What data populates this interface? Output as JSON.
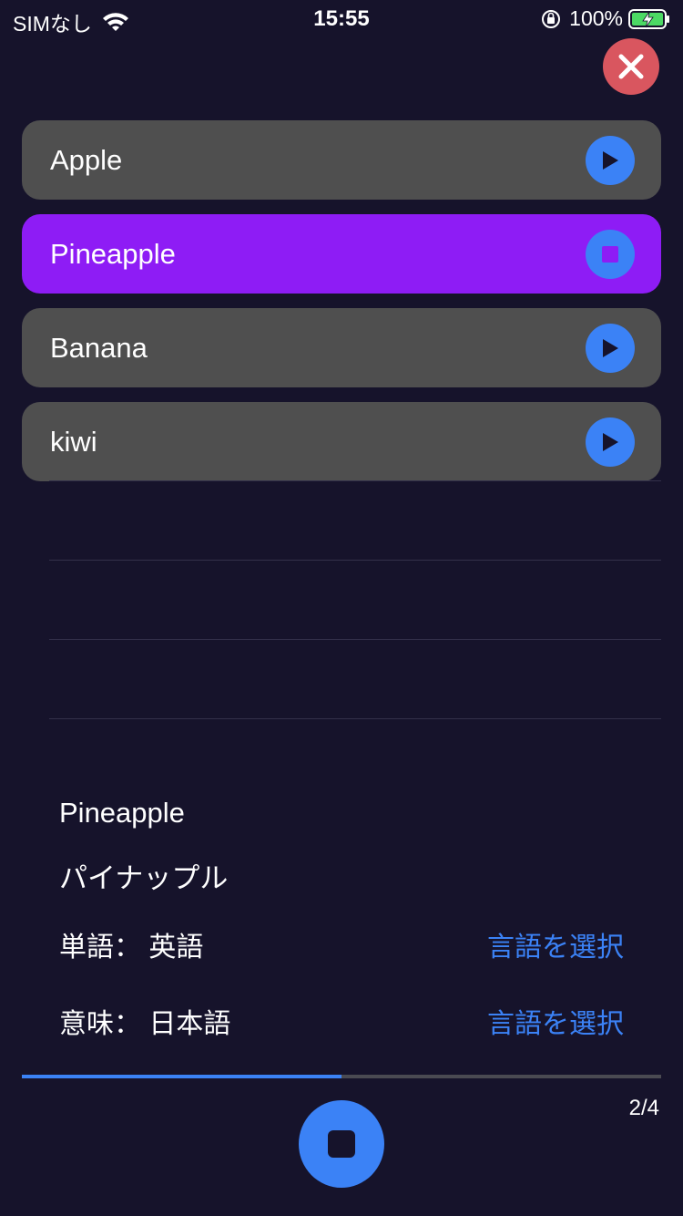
{
  "status_bar": {
    "carrier": "SIMなし",
    "time": "15:55",
    "battery": "100%"
  },
  "words": [
    {
      "label": "Apple",
      "state": "play-icon"
    },
    {
      "label": "Pineapple",
      "state": "stop-icon"
    },
    {
      "label": "Banana",
      "state": "play-icon"
    },
    {
      "label": "kiwi",
      "state": "play-icon"
    }
  ],
  "detail": {
    "word": "Pineapple",
    "meaning": "パイナップル",
    "word_lang_key": "単語：",
    "word_lang_value": "英語",
    "meaning_lang_key": "意味：",
    "meaning_lang_value": "日本語",
    "select_label": "言語を選択"
  },
  "player": {
    "progress": 0.5,
    "page": "2/4"
  },
  "colors": {
    "background": "#16132b",
    "row": "#4f4f4f",
    "active_row": "#8e1cf5",
    "accent": "#3b82f6",
    "close": "#d9565f"
  }
}
